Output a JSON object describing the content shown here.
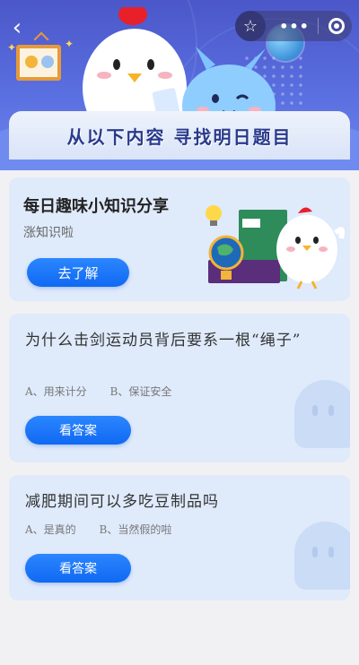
{
  "hero": {
    "banner_title": "从以下内容  寻找明日题目"
  },
  "nav": {
    "back_icon": "chevron-left-icon",
    "star_icon": "star-outline-icon",
    "more_icon": "more-dots-icon",
    "close_icon": "target-close-icon"
  },
  "feature_card": {
    "title": "每日趣味小知识分享",
    "subtitle": "涨知识啦",
    "button_label": "去了解"
  },
  "questions": [
    {
      "title": "为什么击剑运动员背后要系一根“绳子”",
      "options": [
        "A、用来计分",
        "B、保证安全"
      ],
      "button_label": "看答案"
    },
    {
      "title": "减肥期间可以多吃豆制品吗",
      "options": [
        "A、是真的",
        "B、当然假的啦"
      ],
      "button_label": "看答案"
    }
  ],
  "colors": {
    "primary_button": "#1a73f5",
    "card_bg": "#dfeafb",
    "hero_bg": "#5263d6",
    "banner_text": "#2a3a8c"
  }
}
